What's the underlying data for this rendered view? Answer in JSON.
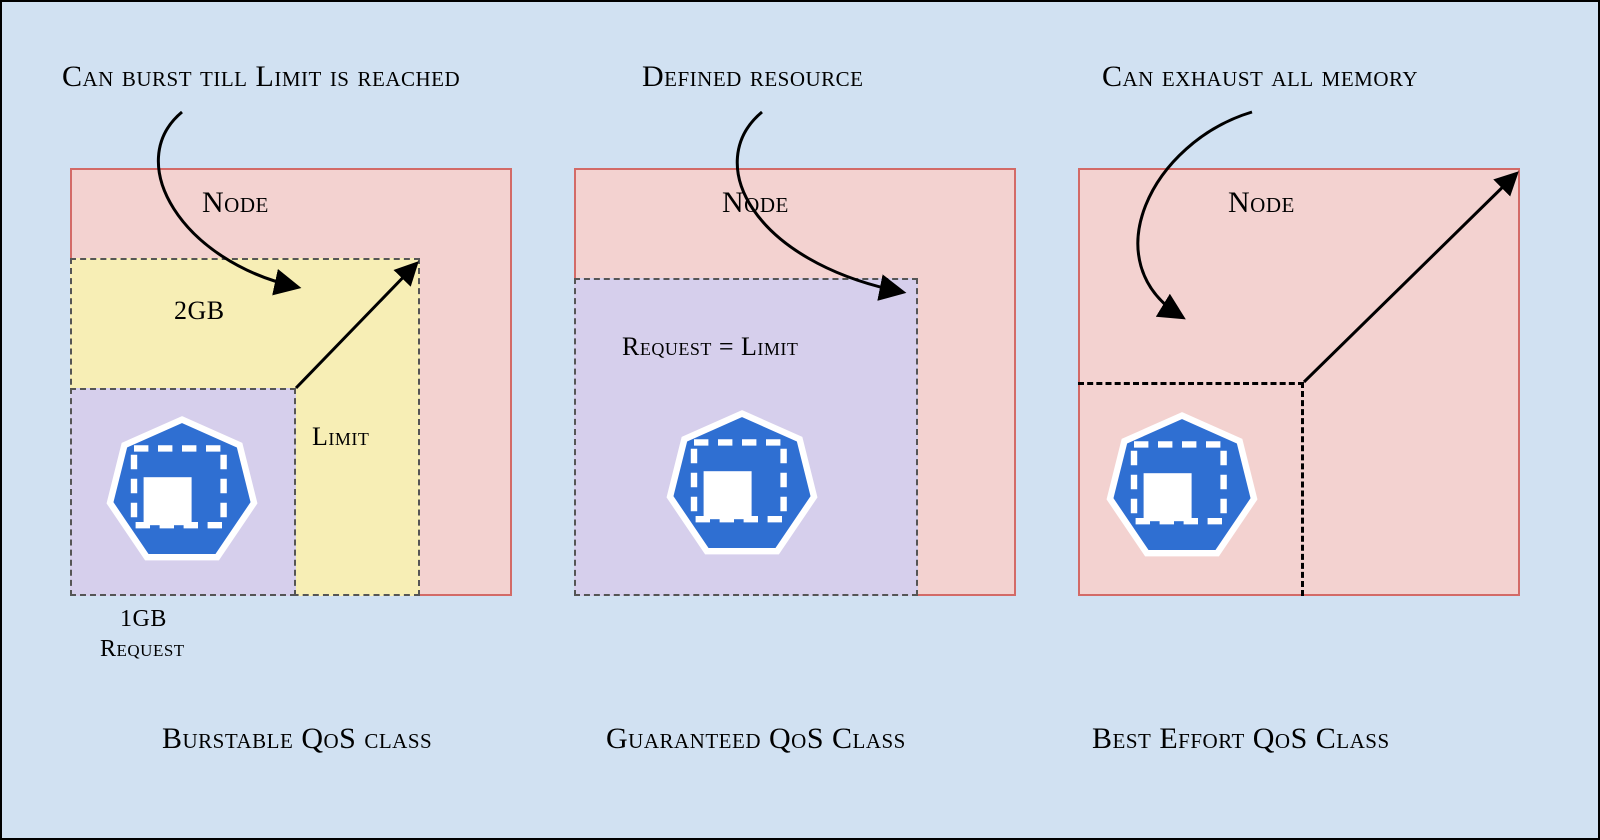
{
  "annotations": {
    "burstable_top": "Can burst till Limit is reached",
    "guaranteed_top": "Defined resource",
    "besteffort_top": "Can exhaust all memory"
  },
  "burstable": {
    "node_label": "Node",
    "limit_size": "2GB",
    "limit_word": "Limit",
    "request_size": "1GB",
    "request_word": "Request",
    "caption": "Burstable QoS class"
  },
  "guaranteed": {
    "node_label": "Node",
    "box_text": "Request = Limit",
    "caption": "Guaranteed QoS Class"
  },
  "besteffort": {
    "node_label": "Node",
    "caption": "Best Effort QoS Class"
  }
}
